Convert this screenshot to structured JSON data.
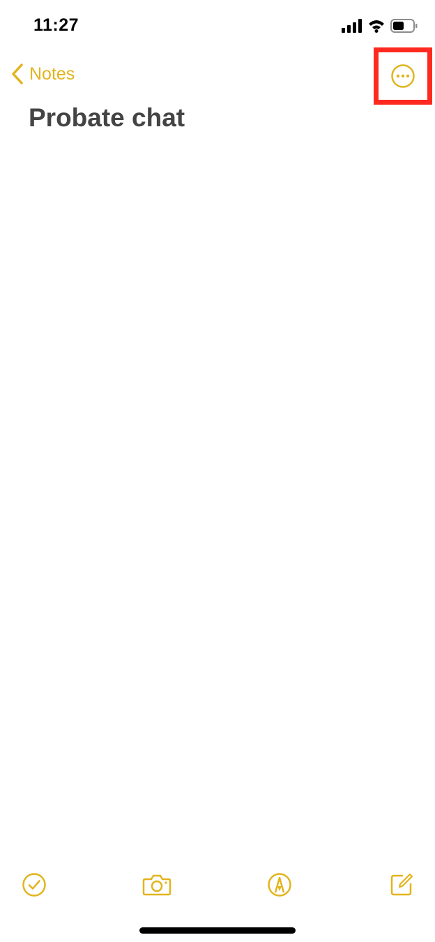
{
  "status_bar": {
    "time": "11:27",
    "icons": [
      "cellular-signal-icon",
      "wifi-icon",
      "battery-icon"
    ]
  },
  "nav": {
    "back_label": "Notes",
    "back_icon": "chevron-left-icon",
    "more_icon": "ellipsis-circle-icon"
  },
  "note": {
    "title": "Probate chat",
    "body": ""
  },
  "toolbar": {
    "items": [
      {
        "icon": "checklist-icon"
      },
      {
        "icon": "camera-icon"
      },
      {
        "icon": "markup-icon"
      },
      {
        "icon": "compose-icon"
      }
    ]
  },
  "colors": {
    "accent": "#E2B41D",
    "title_text": "#444444",
    "highlight_box": "#FF2A1F",
    "background": "#FFFFFF"
  }
}
